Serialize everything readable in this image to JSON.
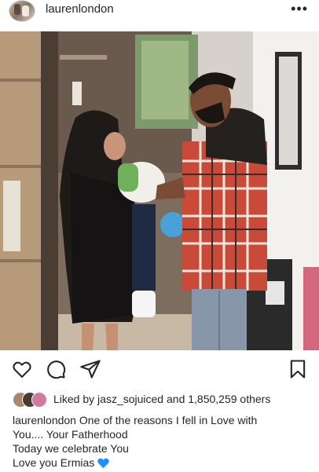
{
  "post": {
    "username": "laurenlondon",
    "more_icon": "more-horizontal-icon",
    "more_glyph": "•••"
  },
  "actions": {
    "like_icon": "heart-outline-icon",
    "comment_icon": "comment-icon",
    "share_icon": "send-icon",
    "save_icon": "bookmark-icon"
  },
  "likes": {
    "prefix": "Liked by",
    "user": "jasz_sojuiced",
    "joiner": "and",
    "count": "1,850,259 others"
  },
  "caption": {
    "username": "laurenlondon",
    "line1": "One of the reasons I fell in Love with",
    "line2": "You.... Your Fatherhood",
    "line3": "Today we celebrate You",
    "line4": "Love you Ermias",
    "emoji_icon": "blue-heart-icon",
    "emoji_color": "#1e90ff"
  }
}
